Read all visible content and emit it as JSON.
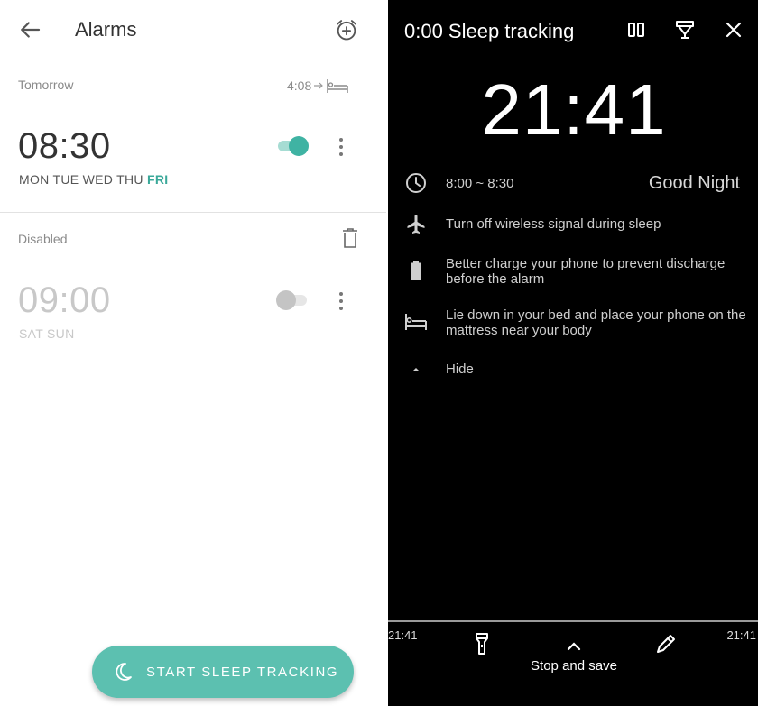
{
  "left": {
    "title": "Alarms",
    "sections": {
      "tomorrow": {
        "label": "Tomorrow",
        "sleep_duration": "4:08"
      },
      "disabled": {
        "label": "Disabled"
      }
    },
    "alarms": [
      {
        "time": "08:30",
        "days_regular": "MON TUE WED THU",
        "days_highlight": "FRI",
        "enabled": true
      },
      {
        "time": "09:00",
        "days_regular": "SAT SUN",
        "days_highlight": "",
        "enabled": false
      }
    ],
    "fab_label": "START SLEEP TRACKING",
    "colors": {
      "accent": "#5cc0b0",
      "text_primary": "#333333",
      "text_disabled": "#c8c8c8"
    }
  },
  "right": {
    "title": "0:00 Sleep tracking",
    "clock": "21:41",
    "window": "8:00 ~ 8:30",
    "greeting": "Good Night",
    "tips": [
      {
        "icon": "airplane-icon",
        "text": "Turn off wireless signal during sleep"
      },
      {
        "icon": "battery-icon",
        "text": "Better charge your phone to prevent discharge before the alarm"
      },
      {
        "icon": "bed-icon",
        "text": "Lie down in your bed and place your phone on the mattress near your body"
      }
    ],
    "hide_label": "Hide",
    "bottom": {
      "time_left": "21:41",
      "time_right": "21:41",
      "stop_label": "Stop and save"
    }
  }
}
